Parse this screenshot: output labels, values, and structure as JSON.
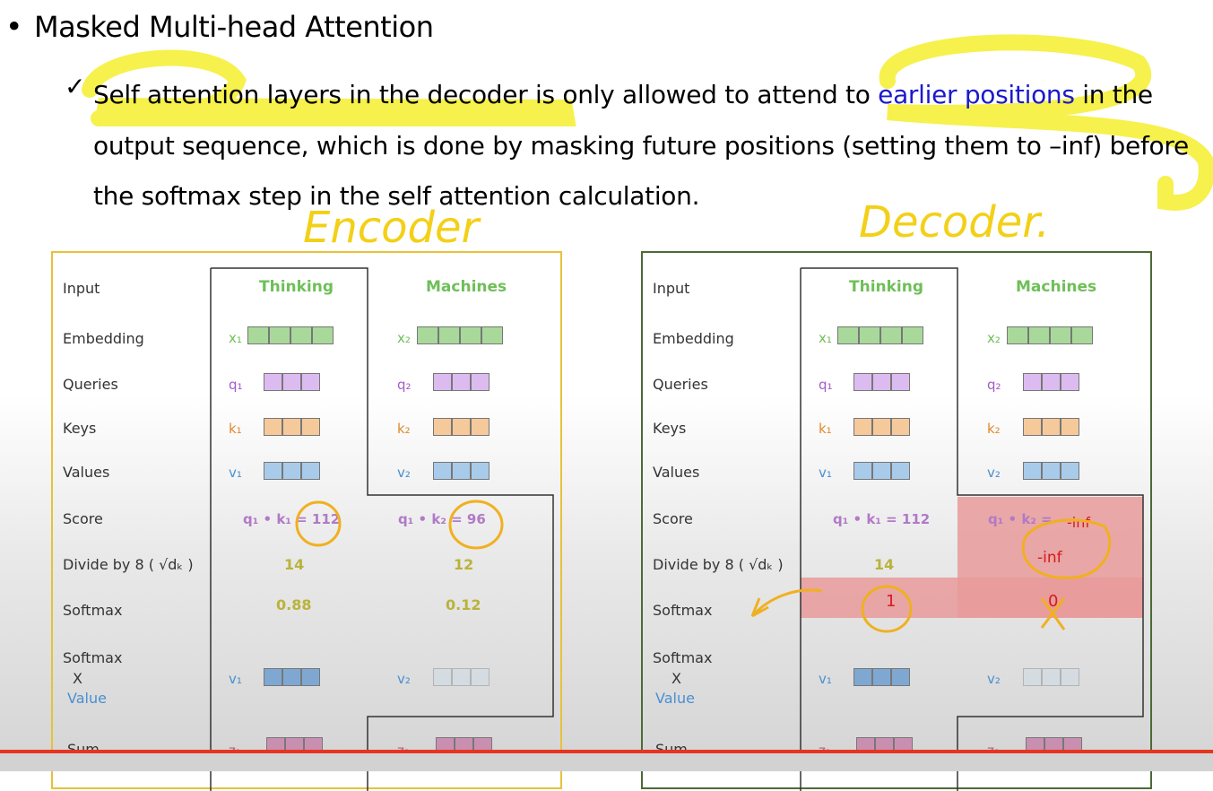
{
  "slide": {
    "bullet": "•",
    "heading": "Masked Multi-head Attention",
    "checkmark": "✓",
    "para_part1": "Self attention layers in the decoder is only allowed to attend to ",
    "para_link": "earlier positions",
    "para_part2": " in the output sequence, which is done by masking future positions (setting them to –inf) before the softmax step in the self attention calculation.",
    "annot_encoder": "Encoder",
    "annot_decoder": "Decoder."
  },
  "encoder": {
    "rows": [
      "Input",
      "Embedding",
      "Queries",
      "Keys",
      "Values",
      "Score",
      "Divide by 8 ( √dₖ )",
      "Softmax",
      "Softmax",
      "X",
      "Value",
      "Sum"
    ],
    "col1_header": "Thinking",
    "col2_header": "Machines",
    "x1": "x₁",
    "x2": "x₂",
    "q1": "q₁",
    "q2": "q₂",
    "k1": "k₁",
    "k2": "k₂",
    "v1": "v₁",
    "v2": "v₂",
    "z1": "z₁",
    "z2": "z₂",
    "score1": "q₁ • k₁ = 112",
    "score2": "q₁ • k₂ = 96",
    "div1": "14",
    "div2": "12",
    "soft1": "0.88",
    "soft2": "0.12"
  },
  "decoder": {
    "rows": [
      "Input",
      "Embedding",
      "Queries",
      "Keys",
      "Values",
      "Score",
      "Divide by 8 ( √dₖ )",
      "Softmax",
      "Softmax",
      "X",
      "Value",
      "Sum"
    ],
    "col1_header": "Thinking",
    "col2_header": "Machines",
    "x1": "x₁",
    "x2": "x₂",
    "q1": "q₁",
    "q2": "q₂",
    "k1": "k₁",
    "k2": "k₂",
    "v1": "v₁",
    "v2": "v₂",
    "z1": "z₁",
    "z2": "z₂",
    "score1": "q₁ • k₁ = 112",
    "score2": "q₁ • k₂ = ",
    "score2_val": "-inf",
    "div1": "14",
    "div2": "-inf",
    "soft1": "1",
    "soft2": "0"
  },
  "colors": {
    "encoder_border": "#e7c13a",
    "decoder_border": "#4d6a37",
    "mask": "#e89a9a",
    "highlight": "#f5ef3a",
    "progress": "#e8341f"
  }
}
